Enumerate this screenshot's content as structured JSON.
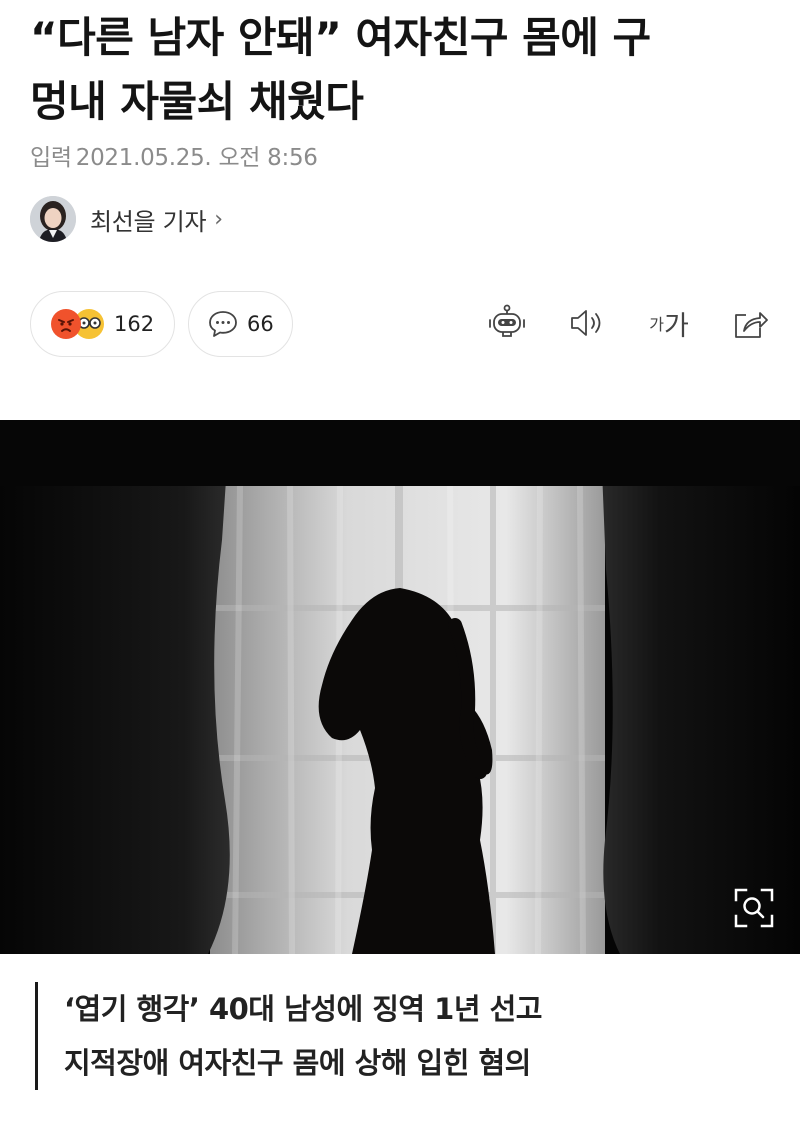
{
  "article": {
    "headline_line1": "“다른 남자 안돼” 여자친구 몸에 구",
    "headline_line2": "멍내 자물쇠 채웠다",
    "date_label": "입력",
    "date_value": "2021.05.25. 오전 8:56"
  },
  "reporter": {
    "name": "최선을 기자",
    "chevron": "›"
  },
  "reactions": {
    "reaction_count": "162",
    "comment_count": "66",
    "emoji_icons": [
      "angry-face-icon",
      "glasses-face-icon"
    ]
  },
  "toolbar": {
    "icons": [
      "robot-summary-icon",
      "speaker-icon",
      "font-size-icon",
      "share-icon"
    ],
    "font_small": "가",
    "font_large": "가"
  },
  "photo": {
    "caption_line1": "‘엽기 행각’ 40대 남성에 징역 1년 선고",
    "caption_line2": "지적장애 여자친구 몸에 상해 입힌 혐의",
    "zoom_icon": "zoom-magnifier-icon"
  },
  "colors": {
    "text": "#141414",
    "meta": "#8b8b8b",
    "angry": "#f0522c",
    "glasses": "#f6c234",
    "photo_bg": "#050505"
  }
}
